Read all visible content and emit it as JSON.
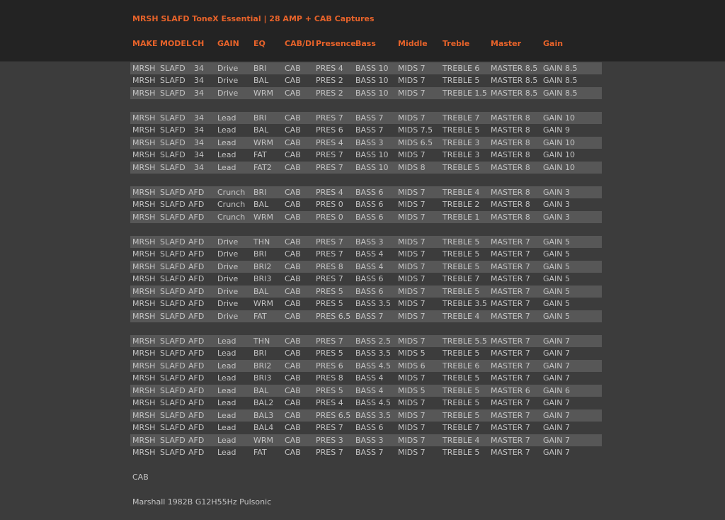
{
  "header": {
    "title": "MRSH SLAFD ToneX Essential | 28 AMP + CAB Captures",
    "columns": [
      "MAKE",
      "MODEL",
      "CH",
      "GAIN",
      "EQ",
      "CAB/DI",
      "Presence",
      "Bass",
      "Middle",
      "Treble",
      "Master",
      "Gain"
    ]
  },
  "groups": [
    [
      [
        "MRSH",
        "SLAFD",
        "34",
        "Drive",
        "BRI",
        "CAB",
        "PRES 4",
        "BASS 10",
        "MIDS 7",
        "TREBLE 6",
        "MASTER 8.5",
        "GAIN 8.5"
      ],
      [
        "MRSH",
        "SLAFD",
        "34",
        "Drive",
        "BAL",
        "CAB",
        "PRES 2",
        "BASS 10",
        "MIDS 7",
        "TREBLE 5",
        "MASTER 8.5",
        "GAIN 8.5"
      ],
      [
        "MRSH",
        "SLAFD",
        "34",
        "Drive",
        "WRM",
        "CAB",
        "PRES 2",
        "BASS 10",
        "MIDS 7",
        "TREBLE 1.5",
        "MASTER 8.5",
        "GAIN 8.5"
      ]
    ],
    [
      [
        "MRSH",
        "SLAFD",
        "34",
        "Lead",
        "BRI",
        "CAB",
        "PRES 7",
        "BASS 7",
        "MIDS 7",
        "TREBLE 7",
        "MASTER 8",
        "GAIN 10"
      ],
      [
        "MRSH",
        "SLAFD",
        "34",
        "Lead",
        "BAL",
        "CAB",
        "PRES 6",
        "BASS 7",
        "MIDS 7.5",
        "TREBLE 5",
        "MASTER 8",
        "GAIN 9"
      ],
      [
        "MRSH",
        "SLAFD",
        "34",
        "Lead",
        "WRM",
        "CAB",
        "PRES 4",
        "BASS 3",
        "MIDS 6.5",
        "TREBLE 3",
        "MASTER 8",
        "GAIN 10"
      ],
      [
        "MRSH",
        "SLAFD",
        "34",
        "Lead",
        "FAT",
        "CAB",
        "PRES 7",
        "BASS 10",
        "MIDS 7",
        "TREBLE 3",
        "MASTER 8",
        "GAIN 10"
      ],
      [
        "MRSH",
        "SLAFD",
        "34",
        "Lead",
        "FAT2",
        "CAB",
        "PRES 7",
        "BASS 10",
        "MIDS 8",
        "TREBLE 5",
        "MASTER 8",
        "GAIN 10"
      ]
    ],
    [
      [
        "MRSH",
        "SLAFD",
        "AFD",
        "Crunch",
        "BRI",
        "CAB",
        "PRES 4",
        "BASS 6",
        "MIDS 7",
        "TREBLE 4",
        "MASTER 8",
        "GAIN 3"
      ],
      [
        "MRSH",
        "SLAFD",
        "AFD",
        "Crunch",
        "BAL",
        "CAB",
        "PRES 0",
        "BASS 6",
        "MIDS 7",
        "TREBLE 2",
        "MASTER 8",
        "GAIN 3"
      ],
      [
        "MRSH",
        "SLAFD",
        "AFD",
        "Crunch",
        "WRM",
        "CAB",
        "PRES 0",
        "BASS 6",
        "MIDS 7",
        "TREBLE 1",
        "MASTER 8",
        "GAIN 3"
      ]
    ],
    [
      [
        "MRSH",
        "SLAFD",
        "AFD",
        "Drive",
        "THN",
        "CAB",
        "PRES 7",
        "BASS 3",
        "MIDS 7",
        "TREBLE 5",
        "MASTER 7",
        "GAIN 5"
      ],
      [
        "MRSH",
        "SLAFD",
        "AFD",
        "Drive",
        "BRI",
        "CAB",
        "PRES 7",
        "BASS 4",
        "MIDS 7",
        "TREBLE 5",
        "MASTER 7",
        "GAIN 5"
      ],
      [
        "MRSH",
        "SLAFD",
        "AFD",
        "Drive",
        "BRI2",
        "CAB",
        "PRES 8",
        "BASS 4",
        "MIDS 7",
        "TREBLE 5",
        "MASTER 7",
        "GAIN 5"
      ],
      [
        "MRSH",
        "SLAFD",
        "AFD",
        "Drive",
        "BRI3",
        "CAB",
        "PRES 7",
        "BASS 6",
        "MIDS 7",
        "TREBLE 7",
        "MASTER 7",
        "GAIN 5"
      ],
      [
        "MRSH",
        "SLAFD",
        "AFD",
        "Drive",
        "BAL",
        "CAB",
        "PRES 5",
        "BASS 6",
        "MIDS 7",
        "TREBLE 5",
        "MASTER 7",
        "GAIN 5"
      ],
      [
        "MRSH",
        "SLAFD",
        "AFD",
        "Drive",
        "WRM",
        "CAB",
        "PRES 5",
        "BASS 3.5",
        "MIDS 7",
        "TREBLE 3.5",
        "MASTER 7",
        "GAIN 5"
      ],
      [
        "MRSH",
        "SLAFD",
        "AFD",
        "Drive",
        "FAT",
        "CAB",
        "PRES 6.5",
        "BASS 7",
        "MIDS 7",
        "TREBLE 4",
        "MASTER 7",
        "GAIN 5"
      ]
    ],
    [
      [
        "MRSH",
        "SLAFD",
        "AFD",
        "Lead",
        "THN",
        "CAB",
        "PRES 7",
        "BASS 2.5",
        "MIDS 7",
        "TREBLE 5.5",
        "MASTER 7",
        "GAIN 7"
      ],
      [
        "MRSH",
        "SLAFD",
        "AFD",
        "Lead",
        "BRI",
        "CAB",
        "PRES 5",
        "BASS 3.5",
        "MIDS 5",
        "TREBLE 5",
        "MASTER 7",
        "GAIN 7"
      ],
      [
        "MRSH",
        "SLAFD",
        "AFD",
        "Lead",
        "BRI2",
        "CAB",
        "PRES 6",
        "BASS 4.5",
        "MIDS 6",
        "TREBLE 6",
        "MASTER 7",
        "GAIN 7"
      ],
      [
        "MRSH",
        "SLAFD",
        "AFD",
        "Lead",
        "BRI3",
        "CAB",
        "PRES 8",
        "BASS 4",
        "MIDS 7",
        "TREBLE 5",
        "MASTER 7",
        "GAIN 7"
      ],
      [
        "MRSH",
        "SLAFD",
        "AFD",
        "Lead",
        "BAL",
        "CAB",
        "PRES 5",
        "BASS 4",
        "MIDS 5",
        "TREBLE 5",
        "MASTER 6",
        "GAIN 6"
      ],
      [
        "MRSH",
        "SLAFD",
        "AFD",
        "Lead",
        "BAL2",
        "CAB",
        "PRES 4",
        "BASS 4.5",
        "MIDS 7",
        "TREBLE 5",
        "MASTER 7",
        "GAIN 7"
      ],
      [
        "MRSH",
        "SLAFD",
        "AFD",
        "Lead",
        "BAL3",
        "CAB",
        "PRES  6.5",
        "BASS 3.5",
        "MIDS 7",
        "TREBLE 5",
        "MASTER 7",
        "GAIN 7"
      ],
      [
        "MRSH",
        "SLAFD",
        "AFD",
        "Lead",
        "BAL4",
        "CAB",
        "PRES 7",
        "BASS 6",
        "MIDS 7",
        "TREBLE 7",
        "MASTER 7",
        "GAIN 7"
      ],
      [
        "MRSH",
        "SLAFD",
        "AFD",
        "Lead",
        "WRM",
        "CAB",
        "PRES 3",
        "BASS 3",
        "MIDS 7",
        "TREBLE 4",
        "MASTER 7",
        "GAIN 7"
      ],
      [
        "MRSH",
        "SLAFD",
        "AFD",
        "Lead",
        "FAT",
        "CAB",
        "PRES 7",
        "BASS 7",
        "MIDS 7",
        "TREBLE 5",
        "MASTER 7",
        "GAIN 7"
      ]
    ]
  ],
  "footer": {
    "cab_label": "CAB",
    "cab_model": "Marshall 1982B G12H55Hz Pulsonic"
  },
  "colors": {
    "accent": "#e8632a",
    "background": "#3c3c3c",
    "header_background": "#232323",
    "row_shade": "#575757",
    "text": "#c4c4c4"
  }
}
